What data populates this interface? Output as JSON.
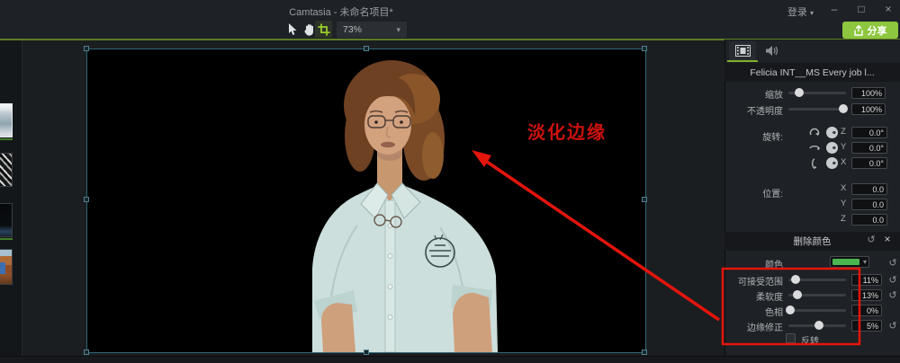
{
  "window": {
    "title": "Camtasia - 未命名项目*",
    "login_label": "登录"
  },
  "toolbar": {
    "zoom_value": "73%",
    "share_label": "分享"
  },
  "media_bin": {
    "items": [
      "framed-photo-thumbnail",
      "bw-pattern-thumbnail",
      "dark-clip-thumbnail",
      "canyon-photo-thumbnail"
    ]
  },
  "stage": {
    "annotation_text": "淡化边缘"
  },
  "properties": {
    "clip_title": "Felicia INT__MS Every job l...",
    "scale_label": "缩放",
    "scale_value": "100%",
    "opacity_label": "不透明度",
    "opacity_value": "100%",
    "rotation_label": "旋转:",
    "rotation_axes": [
      {
        "axis": "Z",
        "value": "0.0°"
      },
      {
        "axis": "Y",
        "value": "0.0°"
      },
      {
        "axis": "X",
        "value": "0.0°"
      }
    ],
    "position_label": "位置:",
    "position_axes": [
      {
        "axis": "X",
        "value": "0.0"
      },
      {
        "axis": "Y",
        "value": "0.0"
      },
      {
        "axis": "Z",
        "value": "0.0"
      }
    ],
    "remove_color": {
      "header": "删除颜色",
      "color_label": "颜色",
      "swatch_color": "#4bb550",
      "sliders": [
        {
          "label": "可接受范围",
          "value": "11%"
        },
        {
          "label": "柔软度",
          "value": "13%"
        },
        {
          "label": "色相",
          "value": "0%"
        },
        {
          "label": "边缘修正",
          "value": "5%"
        }
      ],
      "invert_label": "反转",
      "invert_checked": false
    }
  },
  "icons": {
    "reset": "↺",
    "close": "×",
    "caret_down": "▾",
    "minimize": "–",
    "maximize": "□",
    "window_close": "×"
  },
  "colors": {
    "accent_green": "#7eb02c",
    "share_green": "#8dc63f",
    "annotation_red": "#cc120c",
    "selection_teal": "#336879",
    "swatch_green": "#4bb550"
  }
}
